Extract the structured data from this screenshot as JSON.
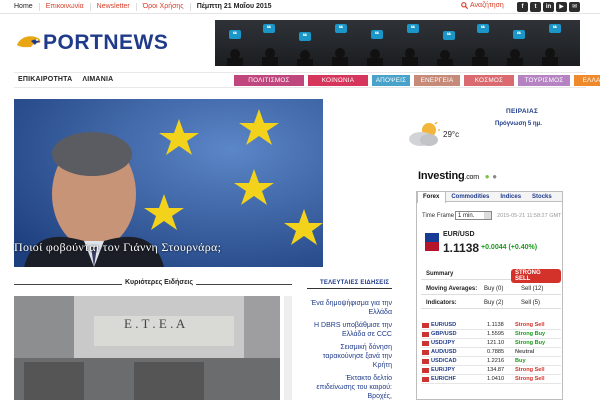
{
  "topbar": {
    "home": "Home",
    "contact": "Επικοινωνία",
    "newsletter": "Newsletter",
    "terms": "Όροι Χρήσης",
    "date": "Πέμπτη 21 Μαΐου 2015",
    "search": "Αναζήτηση",
    "social_icons": [
      "facebook-icon",
      "twitter-icon",
      "linkedin-icon",
      "youtube-icon",
      "email-icon"
    ]
  },
  "logo": {
    "text": "PORTNEWS"
  },
  "nav": {
    "left": [
      "ΕΠΙΚΑΙΡΟΤΗΤΑ",
      "ΛΙΜΑΝΙΑ"
    ],
    "categories": [
      {
        "label": "ΠΟΛΙΤΙΣΜΟΣ",
        "color": "#c0467e"
      },
      {
        "label": "ΚΟΙΝΩΝΙΑ",
        "color": "#d6355c"
      },
      {
        "label": "ΑΠΟΨΕΙΣ",
        "color": "#49a2c9"
      },
      {
        "label": "ΕΝΕΡΓΕΙΑ",
        "color": "#c58a78"
      },
      {
        "label": "ΚΟΣΜΟΣ",
        "color": "#d96a6f"
      },
      {
        "label": "ΤΟΥΡΙΣΜΟΣ",
        "color": "#b583c2"
      },
      {
        "label": "ΕΛΛΑΔΑ",
        "color": "#ef8a2c"
      }
    ]
  },
  "hero": {
    "caption": "Ποιοί φοβούνται τον Γιάννη Στουρνάρα;"
  },
  "main_news": {
    "title": "Κυριότερες Ειδήσεις"
  },
  "latest": {
    "title": "ΤΕΛΕΥΤΑΙΕΣ ΕΙΔΗΣΕΙΣ",
    "items": [
      "Ένα δημοψήφισμα για την Ελλάδα",
      "Η DBRS υποβάθμισε την Ελλάδα σε CCC",
      "Σεισμική δόνηση ταρακούνησε ξανά την Κρήτη",
      "Έκτακτο δελτίο επιδείνωσης του καιρού: Βροχές,"
    ]
  },
  "weather": {
    "location": "ΠΕΙΡΑΙΑΣ",
    "forecast": "Πρόγνωση 5 ημ.",
    "temp": "29°c"
  },
  "investing": {
    "logo": "Investing",
    "logo_suffix": ".com",
    "tabs": [
      "Forex",
      "Commodities",
      "Indices",
      "Stocks"
    ],
    "timeframe_label": "Time Frame",
    "timeframe_value": "1 min.",
    "timestamp": "2015-05-21 11:58:27 GMT",
    "pair": "EUR/USD",
    "price": "1.1138",
    "change": "+0.0044 (+0.40%)",
    "summary_label": "Summary",
    "summary_value": "STRONG SELL",
    "moving_label": "Moving Averages:",
    "moving_buy": "Buy (0)",
    "moving_sell": "Sell (12)",
    "indicators_label": "Indicators:",
    "ind_buy": "Buy (2)",
    "ind_sell": "Sell (5)",
    "rows": [
      {
        "sym": "EUR/USD",
        "val": "1.1138",
        "sig": "Strong Sell",
        "color": "#d3322a"
      },
      {
        "sym": "GBP/USD",
        "val": "1.5595",
        "sig": "Strong Buy",
        "color": "#1a9a1a"
      },
      {
        "sym": "USD/JPY",
        "val": "121.10",
        "sig": "Strong Buy",
        "color": "#1a9a1a"
      },
      {
        "sym": "AUD/USD",
        "val": "0.7885",
        "sig": "Neutral",
        "color": "#555555"
      },
      {
        "sym": "USD/CAD",
        "val": "1.2216",
        "sig": "Buy",
        "color": "#1a9a1a"
      },
      {
        "sym": "EUR/JPY",
        "val": "134.87",
        "sig": "Strong Sell",
        "color": "#d3322a"
      },
      {
        "sym": "EUR/CHF",
        "val": "1.0410",
        "sig": "Strong Sell",
        "color": "#d3322a"
      }
    ]
  }
}
